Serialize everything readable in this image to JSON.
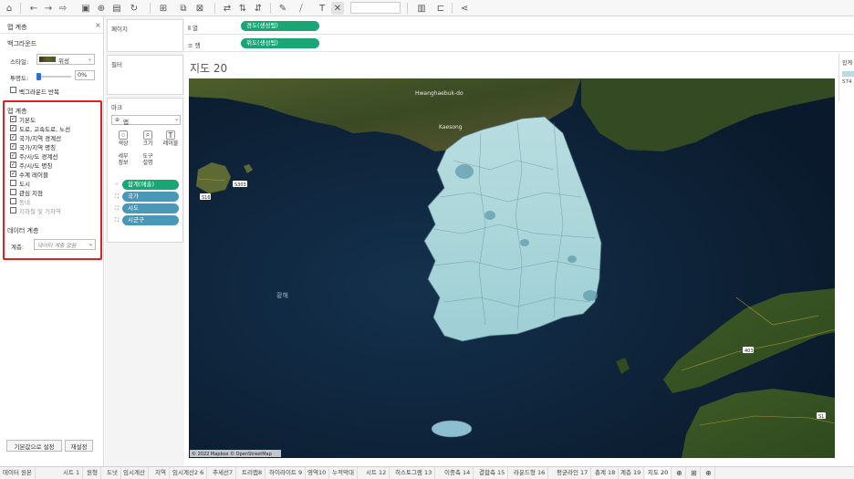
{
  "toolbar": {
    "icons": [
      "home-icon",
      "undo-icon",
      "redo-icon",
      "redo-dropdown-icon",
      "save-icon",
      "add-datasource-icon",
      "pause-icon",
      "refresh-icon",
      "new-sheet-icon",
      "duplicate-icon",
      "clear-icon",
      "swap-icon",
      "sort-asc-icon",
      "sort-desc-icon",
      "highlight-icon",
      "group-icon",
      "label-icon",
      "fix-axes-icon",
      "fit-combo",
      "show-me-icon",
      "presentation-icon",
      "share-icon"
    ]
  },
  "left_panel": {
    "title": "맵 계층",
    "close": "×",
    "background": {
      "title": "백그라운드",
      "style_label": "스타일:",
      "style_value": "위성",
      "opacity_label": "투명도:",
      "opacity_value": "0%",
      "opacity": 0,
      "repeat_label": "백그라운드 반복"
    },
    "map_layers": {
      "title": "맵 계층",
      "items": [
        {
          "label": "기본도",
          "checked": true,
          "dim": false
        },
        {
          "label": "도로, 고속도로, 노선",
          "checked": true,
          "dim": false
        },
        {
          "label": "국가/지역 경계선",
          "checked": true,
          "dim": false
        },
        {
          "label": "국가/지역 명칭",
          "checked": true,
          "dim": false
        },
        {
          "label": "주/시/도 경계선",
          "checked": true,
          "dim": false
        },
        {
          "label": "주/시/도 명칭",
          "checked": true,
          "dim": false
        },
        {
          "label": "수계 레이블",
          "checked": true,
          "dim": false
        },
        {
          "label": "도시",
          "checked": false,
          "dim": false
        },
        {
          "label": "관심 지점",
          "checked": false,
          "dim": false
        },
        {
          "label": "동네",
          "checked": false,
          "dim": true
        },
        {
          "label": "지하철 및 기차역",
          "checked": false,
          "dim": true
        }
      ]
    },
    "data_layer": {
      "title": "데이터 계층",
      "layer_label": "계층:",
      "layer_placeholder": "데이터 계층 없음"
    },
    "reset_default_label": "기본값으로 설정",
    "reset_label": "재설정"
  },
  "pages_card": {
    "title": "페이지"
  },
  "filters_card": {
    "title": "필터"
  },
  "marks_card": {
    "title": "마크",
    "type_value": "맵",
    "buttons": [
      {
        "icon": "color-icon",
        "glyph": "⁘",
        "label": "색상"
      },
      {
        "icon": "size-icon",
        "glyph": "⌕",
        "label": "크기"
      },
      {
        "icon": "label-icon",
        "glyph": "T",
        "label": "레이블"
      },
      {
        "icon": "detail-icon",
        "glyph": "",
        "label": "세부\n정보"
      },
      {
        "icon": "tooltip-icon",
        "glyph": "",
        "label": "도구\n설명"
      }
    ],
    "pills": [
      {
        "label": "합계(매출)",
        "color": "green",
        "icon": "⁘"
      },
      {
        "label": "국가",
        "color": "teal",
        "icon": "⛶"
      },
      {
        "label": "시도",
        "color": "teal",
        "icon": "⛶"
      },
      {
        "label": "시군구",
        "color": "teal",
        "icon": "⛶"
      }
    ]
  },
  "shelves": {
    "columns_label": "열",
    "columns_pill": "경도(생성됨)",
    "rows_label": "행",
    "rows_pill": "위도(생성됨)"
  },
  "sheet": {
    "title": "지도 20",
    "map_labels": {
      "hwanghae": "Hwanghaebuk-do",
      "kaesong": "Kaesong",
      "yellow_sea": "황해",
      "road_5303": "S303",
      "road_s16": "S16",
      "road_s1": "S1",
      "road_403": "403",
      "attribution": "© 2022 Mapbox © OpenStreetMap"
    },
    "legend_partial_title": "합계",
    "legend_partial_value": "574"
  },
  "colors": {
    "accent_green": "#1aa574",
    "accent_teal": "#4a98b8",
    "highlight_red": "#e02020",
    "sea": "#0c1f33"
  },
  "tabs": [
    {
      "label": "데이터 원본",
      "active": false
    },
    {
      "label": "시트 1",
      "active": false
    },
    {
      "label": "원형",
      "active": false
    },
    {
      "label": "도넛",
      "active": false
    },
    {
      "label": "임시계산",
      "active": false
    },
    {
      "label": "지역",
      "active": false
    },
    {
      "label": "임시계산2 6",
      "active": false
    },
    {
      "label": "추세선7",
      "active": false
    },
    {
      "label": "트리맵8",
      "active": false
    },
    {
      "label": "하이라이트 9",
      "active": false
    },
    {
      "label": "영역10",
      "active": false
    },
    {
      "label": "누적막대",
      "active": false
    },
    {
      "label": "시트 12",
      "active": false
    },
    {
      "label": "히스토그램 13",
      "active": false
    },
    {
      "label": "이중축 14",
      "active": false
    },
    {
      "label": "결합축 15",
      "active": false
    },
    {
      "label": "라운드형 16",
      "active": false
    },
    {
      "label": "평균라인 17",
      "active": false
    },
    {
      "label": "총계 18",
      "active": false
    },
    {
      "label": "계층 19",
      "active": false
    },
    {
      "label": "지도 20",
      "active": true
    }
  ]
}
